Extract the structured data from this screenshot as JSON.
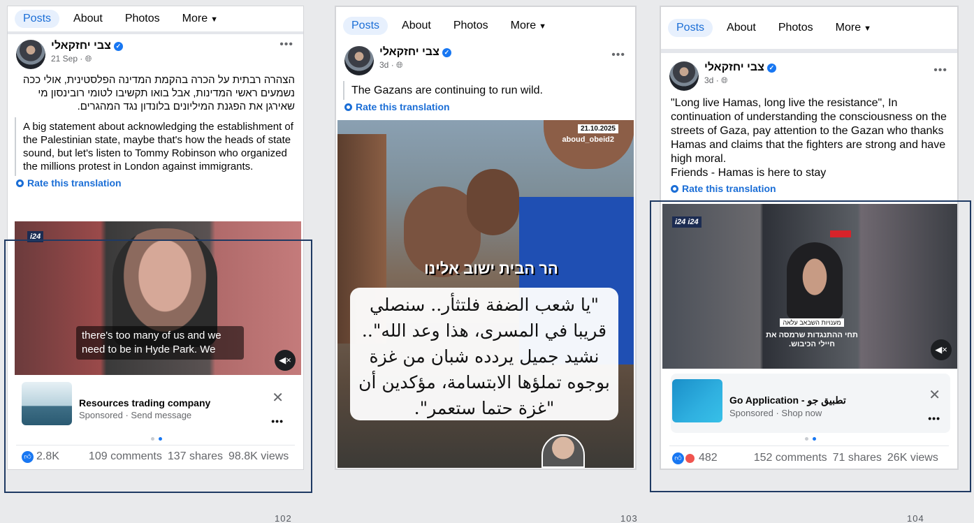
{
  "posts": [
    {
      "tabs": [
        "Posts",
        "About",
        "Photos",
        "More"
      ],
      "author": "צבי יחזקאלי",
      "time": "21 Sep",
      "hebrew_text": "הצהרה רבתית על הכרה בהקמת המדינה הפלסטינית, אולי ככה נשמעים ראשי המדינות, אבל בואו תקשיבו לטומי רובינסון מי שאירגן את הפגנת המיליונים בלונדון נגד המהגרים.",
      "translation": "A big statement about acknowledging the establishment of the Palestinian state, maybe that's how the heads of state sound, but let's listen to Tommy Robinson who organized the millions protest in London against immigrants.",
      "rate": "Rate this translation",
      "video_caption": "there's too many of us and we need to be in Hyde Park. We",
      "video_logo": "i24",
      "ad": {
        "title": "Resources trading company",
        "sub": "Sponsored · Send message"
      },
      "reactions": "2.8K",
      "comments": "109 comments",
      "shares": "137 shares",
      "views": "98.8K views",
      "page": "102"
    },
    {
      "tabs": [
        "Posts",
        "About",
        "Photos",
        "More"
      ],
      "author": "צבי יחזקאלי",
      "time": "3d",
      "translation": "The Gazans are continuing to run wild.",
      "rate": "Rate this translation",
      "date_stamp": "21.10.2025",
      "handle": "aboud_obeid2",
      "hebrew_banner": "הר הבית ישוב אלינו",
      "arabic_text": "\"يا شعب الضفة فلتثأر.. سنصلي قريبا في المسرى، هذا وعد الله\".. نشيد جميل يردده شبان من غزة بوجوه تملؤها الابتسامة، مؤكدين أن \"غزة حتما ستعمر\".",
      "page": "103"
    },
    {
      "tabs": [
        "Posts",
        "About",
        "Photos",
        "More"
      ],
      "author": "צבי יחזקאלי",
      "time": "3d",
      "translation": "\"Long live Hamas, long live the resistance\", In continuation of understanding the consciousness on the streets of Gaza, pay attention to the Gazan who thanks Hamas and claims that the fighters are strong and have high moral.\nFriends - Hamas is here to stay",
      "rate": "Rate this translation",
      "video_logo": "i24 i24",
      "video_caption_1": "מענויות השבאב עלאה",
      "video_caption_2": "תחי ההתנגדות שרמסה את חיילי הכיבוש.",
      "ad": {
        "title": "Go Application - تطبيق جو",
        "sub": "Sponsored · Shop now"
      },
      "reactions": "482",
      "comments": "152 comments",
      "shares": "71 shares",
      "views": "26K views",
      "page": "104"
    }
  ],
  "colors": {
    "accent": "#1877f2",
    "tab_active_bg": "#e7f0fd",
    "highlight_border": "#1f3a63"
  }
}
